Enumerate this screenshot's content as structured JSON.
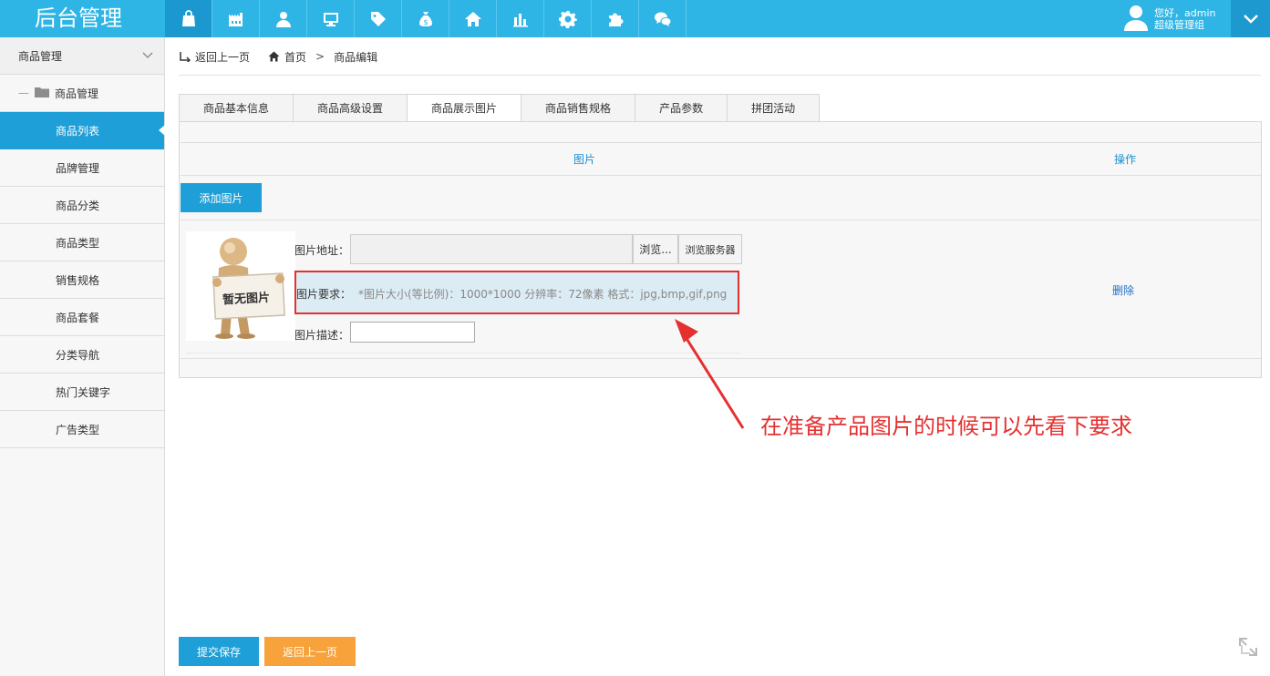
{
  "app": {
    "title": "后台管理"
  },
  "topnav": {
    "icons": [
      "shopping-bag-icon",
      "factory-icon",
      "user-icon",
      "monitor-icon",
      "tag-icon",
      "money-bag-icon",
      "home-icon",
      "bar-chart-icon",
      "gear-icon",
      "puzzle-icon",
      "wechat-icon"
    ],
    "active_index": 0
  },
  "user": {
    "greeting": "您好，admin",
    "role": "超级管理组"
  },
  "sidebar": {
    "header": "商品管理",
    "group": "商品管理",
    "items": [
      {
        "label": "商品列表",
        "active": true
      },
      {
        "label": "品牌管理"
      },
      {
        "label": "商品分类"
      },
      {
        "label": "商品类型"
      },
      {
        "label": "销售规格"
      },
      {
        "label": "商品套餐"
      },
      {
        "label": "分类导航"
      },
      {
        "label": "热门关键字"
      },
      {
        "label": "广告类型"
      }
    ]
  },
  "breadcrumb": {
    "back": "返回上一页",
    "home": "首页",
    "sep": ">",
    "current": "商品编辑"
  },
  "tabs": [
    {
      "label": "商品基本信息"
    },
    {
      "label": "商品高级设置"
    },
    {
      "label": "商品展示图片",
      "active": true
    },
    {
      "label": "商品销售规格"
    },
    {
      "label": "产品参数"
    },
    {
      "label": "拼团活动"
    }
  ],
  "table": {
    "col_picture": "图片",
    "col_action": "操作"
  },
  "image_row": {
    "add_button": "添加图片",
    "placeholder_text": "暂无图片",
    "address_label": "图片地址：",
    "browse_button": "浏览...",
    "server_button": "浏览服务器",
    "requirement_label": "图片要求：",
    "requirement_text": "*图片大小(等比例)：1000*1000 分辨率：72像素 格式：jpg,bmp,gif,png",
    "description_label": "图片描述：",
    "delete_link": "删除"
  },
  "annotation": {
    "text": "在准备产品图片的时候可以先看下要求",
    "color": "#e53030"
  },
  "footer": {
    "save_button": "提交保存",
    "back_button": "返回上一页"
  },
  "colors": {
    "primary": "#2fb5e5",
    "sidebar_active": "#1e9fd7",
    "orange": "#f7a23a"
  }
}
